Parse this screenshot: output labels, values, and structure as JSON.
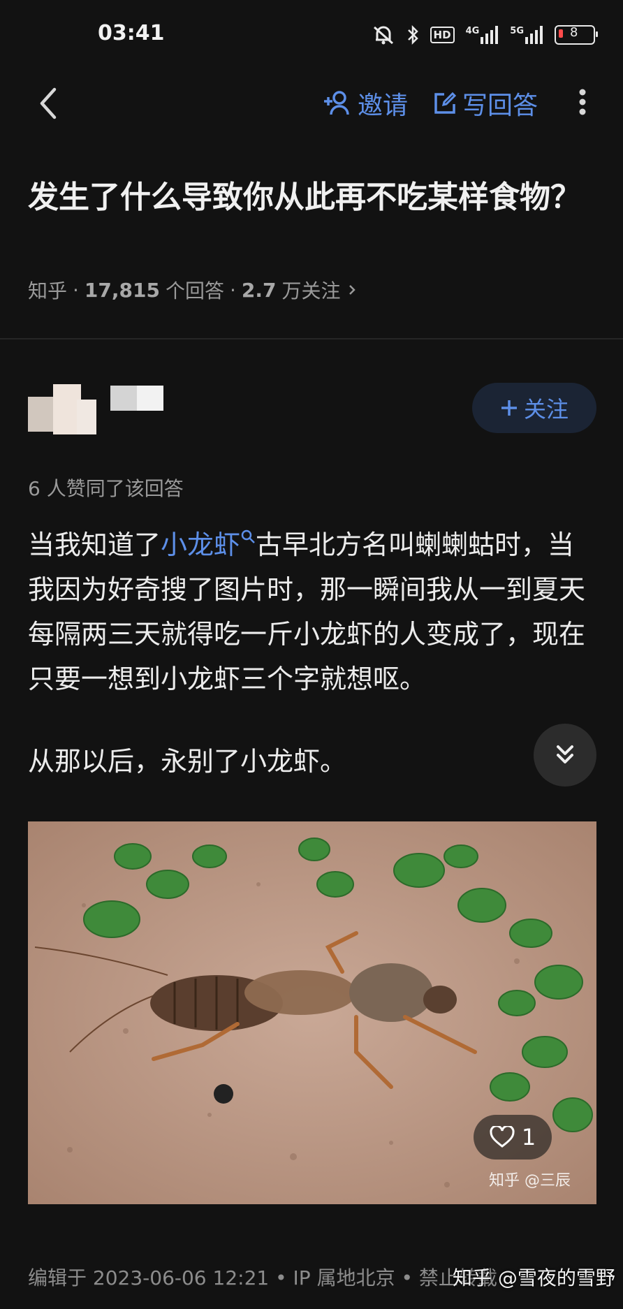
{
  "status_bar": {
    "time": "03:41",
    "hd_label": "HD",
    "net1": "4G",
    "net2": "5G",
    "battery": "8"
  },
  "nav": {
    "invite_label": "邀请",
    "write_answer_label": "写回答"
  },
  "question": {
    "title": "发生了什么导致你从此再不吃某样食物？",
    "source": "知乎",
    "answers_count": "17,815",
    "answers_label": "个回答",
    "followers_count": "2.7",
    "followers_label": "万关注"
  },
  "answer": {
    "follow_label": "关注",
    "likes_text": "6 人赞同了该回答",
    "content_part1": "当我知道了",
    "link_word": "小龙虾",
    "content_part2": "古早北方名叫蝲蝲蛄时，当我因为好奇搜了图片时，那一瞬间我从一到夏天每隔两三天就得吃一斤小龙虾的人变成了，现在只要一想到小龙虾三个字就想呕。",
    "content_para2": "从那以后，永别了小龙虾。",
    "image_like_count": "1",
    "image_watermark": "知乎 @三辰",
    "edited_meta": "编辑于 2023-06-06 12:21 • IP 属地北京 • 禁止转载",
    "page_watermark": "知乎 @雪夜的雪野"
  },
  "colors": {
    "background": "#121212",
    "accent_blue": "#5d8fe8",
    "muted_text": "#9a9a9a"
  }
}
